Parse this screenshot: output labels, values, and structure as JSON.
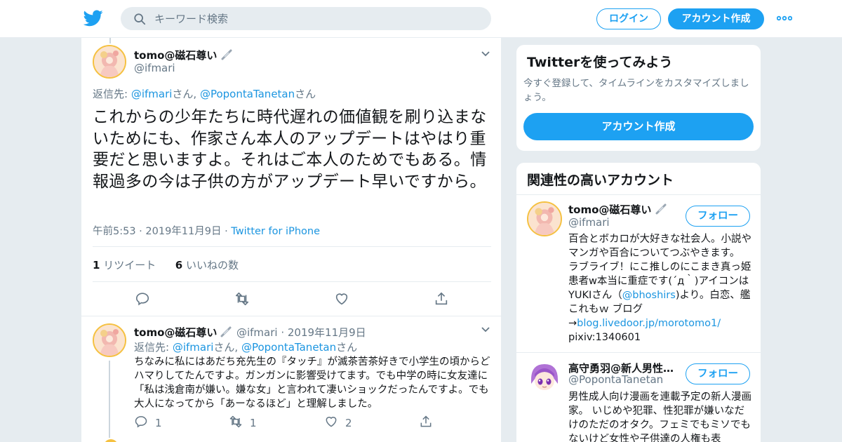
{
  "header": {
    "logo": "twitter-bird-icon",
    "search_placeholder": "キーワード検索",
    "login_label": "ログイン",
    "signup_label": "アカウント作成"
  },
  "tweet": {
    "author_name": "tomo@磁石尊い",
    "author_handle": "@ifmari",
    "reply_prefix": "返信先: ",
    "reply_user1": "@ifmari",
    "reply_san1": "さん, ",
    "reply_user2": "@PopontaTanetan",
    "reply_san2": "さん",
    "text": "これからの少年たちに時代遅れの価値観を刷り込まないためにも、作家さん本人のアップデートはやはり重要だと思いますよ。それはご本人のためでもある。情報過多の今は子供の方がアップデート早いですから。",
    "time": "午前5:53 · 2019年11月9日 · ",
    "source": "Twitter for iPhone",
    "retweet_count": "1",
    "retweet_label": " リツイート",
    "like_count": "6",
    "like_label": " いいねの数"
  },
  "reply": {
    "author_name": "tomo@磁石尊い",
    "meta": " @ifmari · 2019年11月9日",
    "reply_prefix": "返信先: ",
    "reply_user1": "@ifmari",
    "reply_san1": "さん, ",
    "reply_user2": "@PopontaTanetan",
    "reply_san2": "さん",
    "text": "ちなみに私にはあだち充先生の『タッチ』が滅茶苦茶好きで小学生の頃からどハマりしてたんですよ。ガンガンに影響受けてます。でも中学の時に女友達に「私は浅倉南が嫌い。嫌な女」と言われて凄いショックだったんですよ。でも大人になってから「あーなるほど」と理解しました。",
    "reply_count": "1",
    "retweet_count": "1",
    "like_count": "2"
  },
  "sidebar": {
    "try_title": "Twitterを使ってみよう",
    "try_sub": "今すぐ登録して、タイムラインをカスタマイズしましょう。",
    "try_button": "アカウント作成",
    "related_title": "関連性の高いアカウント",
    "follow_label": "フォロー",
    "accounts": [
      {
        "name": "tomo@磁石尊い",
        "handle": "@ifmari",
        "bio_1": "百合とボカロが大好きな社会人。小説やマンガや百合についてつぶやきます。 ラブライブ！にこ推しのにこまき真っ姫患者w本当に重症です(´д｀)アイコンはYUKIさん（",
        "bio_link1": "@bhoshirs",
        "bio_2": ")より。白恋、艦これもｗ ブログ→",
        "bio_link2": "blog.livedoor.jp/morotomo1/",
        "bio_3": " pixiv:1340601"
      },
      {
        "name": "高守勇羽@新人男性向け…",
        "handle": "@PopontaTanetan",
        "bio": "男性成人向け漫画を連載予定の新人漫画家。 いじめや犯罪、性犯罪が嫌いなだけのただのオタク。フェミでもミソでもないけど女性や子供達の人権も表"
      }
    ]
  }
}
